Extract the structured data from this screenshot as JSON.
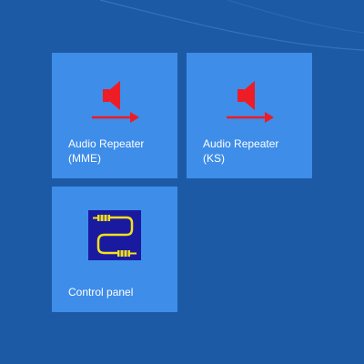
{
  "tiles": [
    {
      "label": "Audio Repeater\n(MME)",
      "icon": "speaker-arrow-icon"
    },
    {
      "label": "Audio Repeater\n(KS)",
      "icon": "speaker-arrow-icon"
    },
    {
      "label": "Control panel",
      "icon": "audio-cable-icon"
    }
  ],
  "colors": {
    "background": "#1d5aa6",
    "tile": "#3e8de9",
    "speaker": "#ee1c24",
    "cable_panel": "#1a1aa0",
    "cable": "#f5e11a"
  }
}
